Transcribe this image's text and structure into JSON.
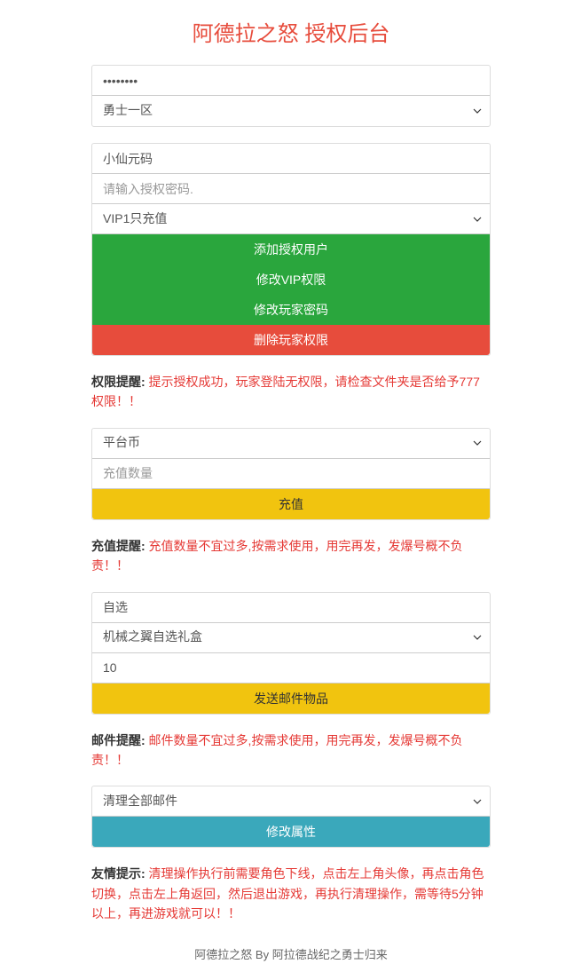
{
  "title": "阿德拉之怒 授权后台",
  "section1": {
    "password_value": "••••••••",
    "server_option": "勇士一区"
  },
  "section2": {
    "username_value": "小仙元码",
    "auth_password_placeholder": "请输入授权密码.",
    "vip_option": "VIP1只充值",
    "btn_add": "添加授权用户",
    "btn_modify_vip": "修改VIP权限",
    "btn_modify_pwd": "修改玩家密码",
    "btn_delete": "删除玩家权限"
  },
  "alert_perm_label": "权限提醒:",
  "alert_perm_text": " 提示授权成功，玩家登陆无权限，请检查文件夹是否给予777权限！！",
  "section3": {
    "currency_option": "平台币",
    "amount_placeholder": "充值数量",
    "btn_recharge": "充值"
  },
  "alert_recharge_label": "充值提醒:",
  "alert_recharge_text": " 充值数量不宜过多,按需求使用，用完再发，发爆号概不负责！！",
  "section4": {
    "type_value": "自选",
    "item_option": "机械之翼自选礼盒",
    "qty_value": "10",
    "btn_send_mail": "发送邮件物品"
  },
  "alert_mail_label": "邮件提醒:",
  "alert_mail_text": " 邮件数量不宜过多,按需求使用，用完再发，发爆号概不负责！！",
  "section5": {
    "cleanup_option": "清理全部邮件",
    "btn_modify_attr": "修改属性"
  },
  "alert_friend_label": "友情提示:",
  "alert_friend_text": " 清理操作执行前需要角色下线，点击左上角头像，再点击角色切换，点击左上角返回，然后退出游戏，再执行清理操作，需等待5分钟以上，再进游戏就可以！！",
  "footer": "阿德拉之怒 By 阿拉德战纪之勇士归来"
}
